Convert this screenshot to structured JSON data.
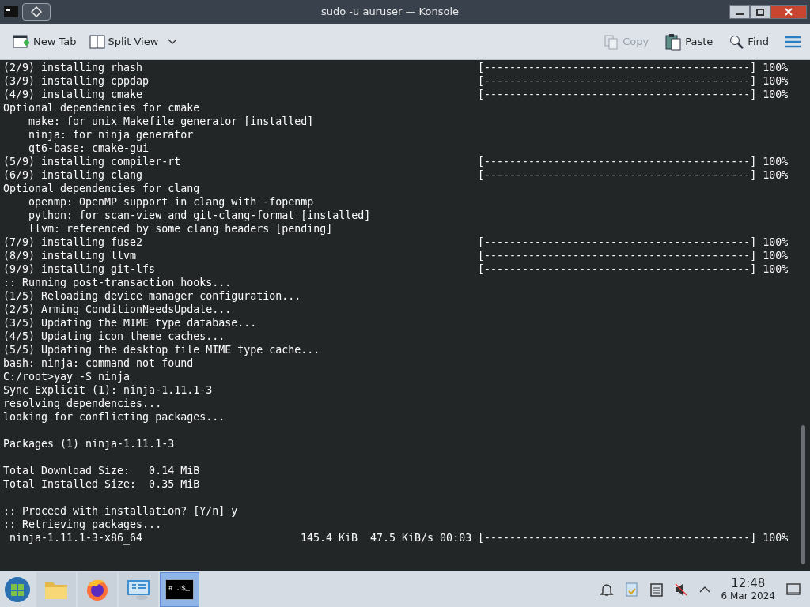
{
  "window": {
    "title": "sudo -u auruser — Konsole"
  },
  "toolbar": {
    "left": [
      {
        "label": "New Tab",
        "kind": "new-tab",
        "disabled": false
      },
      {
        "label": "Split View",
        "kind": "split",
        "disabled": false
      }
    ],
    "right": [
      {
        "label": "Copy",
        "kind": "copy",
        "disabled": true
      },
      {
        "label": "Paste",
        "kind": "paste",
        "disabled": false
      },
      {
        "label": "Find",
        "kind": "find",
        "disabled": false
      }
    ]
  },
  "terminal": {
    "lines": [
      {
        "kind": "text",
        "text": "(2/9) installing rhash",
        "bar": "[------------------------------------------]",
        "percent": "100%"
      },
      {
        "kind": "text",
        "text": "(3/9) installing cppdap",
        "bar": "[------------------------------------------]",
        "percent": "100%"
      },
      {
        "kind": "text",
        "text": "(4/9) installing cmake",
        "bar": "[------------------------------------------]",
        "percent": "100%"
      },
      {
        "kind": "text",
        "text": "Optional dependencies for cmake"
      },
      {
        "kind": "text",
        "text": "    make: for unix Makefile generator [installed]"
      },
      {
        "kind": "text",
        "text": "    ninja: for ninja generator"
      },
      {
        "kind": "text",
        "text": "    qt6-base: cmake-gui"
      },
      {
        "kind": "text",
        "text": "(5/9) installing compiler-rt",
        "bar": "[------------------------------------------]",
        "percent": "100%"
      },
      {
        "kind": "text",
        "text": "(6/9) installing clang",
        "bar": "[------------------------------------------]",
        "percent": "100%"
      },
      {
        "kind": "text",
        "text": "Optional dependencies for clang"
      },
      {
        "kind": "text",
        "text": "    openmp: OpenMP support in clang with -fopenmp"
      },
      {
        "kind": "text",
        "text": "    python: for scan-view and git-clang-format [installed]"
      },
      {
        "kind": "text",
        "text": "    llvm: referenced by some clang headers [pending]"
      },
      {
        "kind": "text",
        "text": "(7/9) installing fuse2",
        "bar": "[------------------------------------------]",
        "percent": "100%"
      },
      {
        "kind": "text",
        "text": "(8/9) installing llvm",
        "bar": "[------------------------------------------]",
        "percent": "100%"
      },
      {
        "kind": "text",
        "text": "(9/9) installing git-lfs",
        "bar": "[------------------------------------------]",
        "percent": "100%"
      },
      {
        "kind": "text",
        "text": ":: Running post-transaction hooks..."
      },
      {
        "kind": "text",
        "text": "(1/5) Reloading device manager configuration..."
      },
      {
        "kind": "text",
        "text": "(2/5) Arming ConditionNeedsUpdate..."
      },
      {
        "kind": "text",
        "text": "(3/5) Updating the MIME type database..."
      },
      {
        "kind": "text",
        "text": "(4/5) Updating icon theme caches..."
      },
      {
        "kind": "text",
        "text": "(5/5) Updating the desktop file MIME type cache..."
      },
      {
        "kind": "text",
        "text": "bash: ninja: command not found"
      },
      {
        "kind": "text",
        "text": "C:/root>yay -S ninja"
      },
      {
        "kind": "text",
        "text": "Sync Explicit (1): ninja-1.11.1-3"
      },
      {
        "kind": "text",
        "text": "resolving dependencies..."
      },
      {
        "kind": "text",
        "text": "looking for conflicting packages..."
      },
      {
        "kind": "blank"
      },
      {
        "kind": "text",
        "text": "Packages (1) ninja-1.11.1-3"
      },
      {
        "kind": "blank"
      },
      {
        "kind": "text",
        "text": "Total Download Size:   0.14 MiB"
      },
      {
        "kind": "text",
        "text": "Total Installed Size:  0.35 MiB"
      },
      {
        "kind": "blank"
      },
      {
        "kind": "text",
        "text": ":: Proceed with installation? [Y/n] y"
      },
      {
        "kind": "text",
        "text": ":: Retrieving packages..."
      },
      {
        "kind": "text",
        "text": " ninja-1.11.1-3-x86_64",
        "info": "145.4 KiB  47.5 KiB/s 00:03",
        "bar": "[------------------------------------------]",
        "percent": "100%"
      }
    ]
  },
  "taskbar": {
    "apps": [
      {
        "kind": "folder",
        "selected": false
      },
      {
        "kind": "browser",
        "selected": false
      },
      {
        "kind": "network",
        "selected": false
      },
      {
        "kind": "terminal",
        "label": "#`J$_",
        "selected": true
      }
    ],
    "clock": {
      "time": "12:48",
      "date": "6 Mar 2024"
    }
  }
}
